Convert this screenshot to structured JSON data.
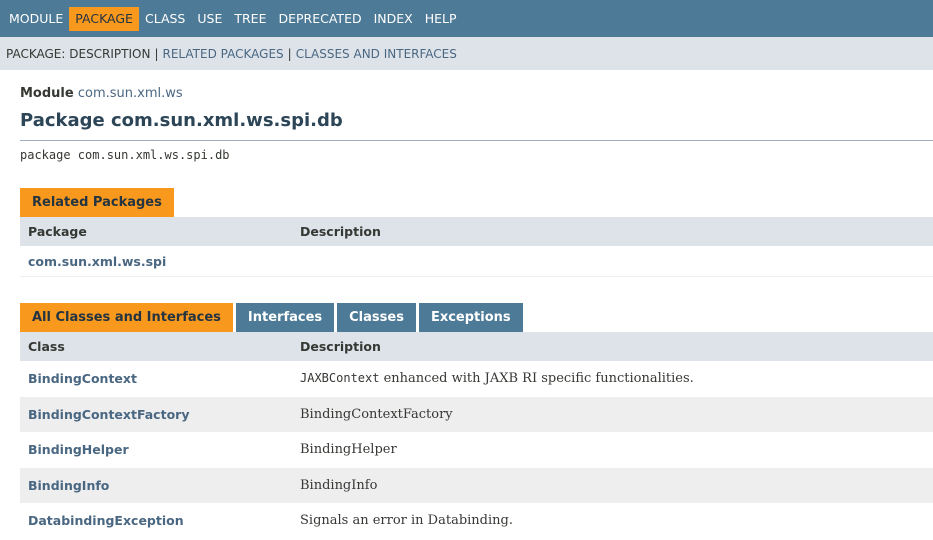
{
  "topnav": {
    "items": [
      {
        "label": "MODULE",
        "active": false
      },
      {
        "label": "PACKAGE",
        "active": true
      },
      {
        "label": "CLASS",
        "active": false
      },
      {
        "label": "USE",
        "active": false
      },
      {
        "label": "TREE",
        "active": false
      },
      {
        "label": "DEPRECATED",
        "active": false
      },
      {
        "label": "INDEX",
        "active": false
      },
      {
        "label": "HELP",
        "active": false
      }
    ]
  },
  "subnav": {
    "description_label": "PACKAGE: DESCRIPTION",
    "separator": "|",
    "related_link": "RELATED PACKAGES",
    "classes_link": "CLASSES AND INTERFACES"
  },
  "header": {
    "module_label": "Module",
    "module_name": "com.sun.xml.ws",
    "title": "Package com.sun.xml.ws.spi.db",
    "declaration": "package com.sun.xml.ws.spi.db"
  },
  "related": {
    "caption": "Related Packages",
    "col_package": "Package",
    "col_description": "Description",
    "rows": [
      {
        "name": "com.sun.xml.ws.spi",
        "description": ""
      }
    ]
  },
  "classes": {
    "tabs": [
      {
        "label": "All Classes and Interfaces",
        "active": true
      },
      {
        "label": "Interfaces",
        "active": false
      },
      {
        "label": "Classes",
        "active": false
      },
      {
        "label": "Exceptions",
        "active": false
      }
    ],
    "col_class": "Class",
    "col_description": "Description",
    "rows": [
      {
        "name": "BindingContext",
        "code": "JAXBContext",
        "description": " enhanced with JAXB RI specific functionalities."
      },
      {
        "name": "BindingContextFactory",
        "code": "",
        "description": "BindingContextFactory"
      },
      {
        "name": "BindingHelper",
        "code": "",
        "description": "BindingHelper"
      },
      {
        "name": "BindingInfo",
        "code": "",
        "description": "BindingInfo"
      },
      {
        "name": "DatabindingException",
        "code": "",
        "description": "Signals an error in Databinding."
      }
    ]
  },
  "colors": {
    "nav_bg": "#4d7a97",
    "accent_orange": "#f8981d",
    "subnav_bg": "#dee3e9",
    "link": "#4a6782"
  }
}
